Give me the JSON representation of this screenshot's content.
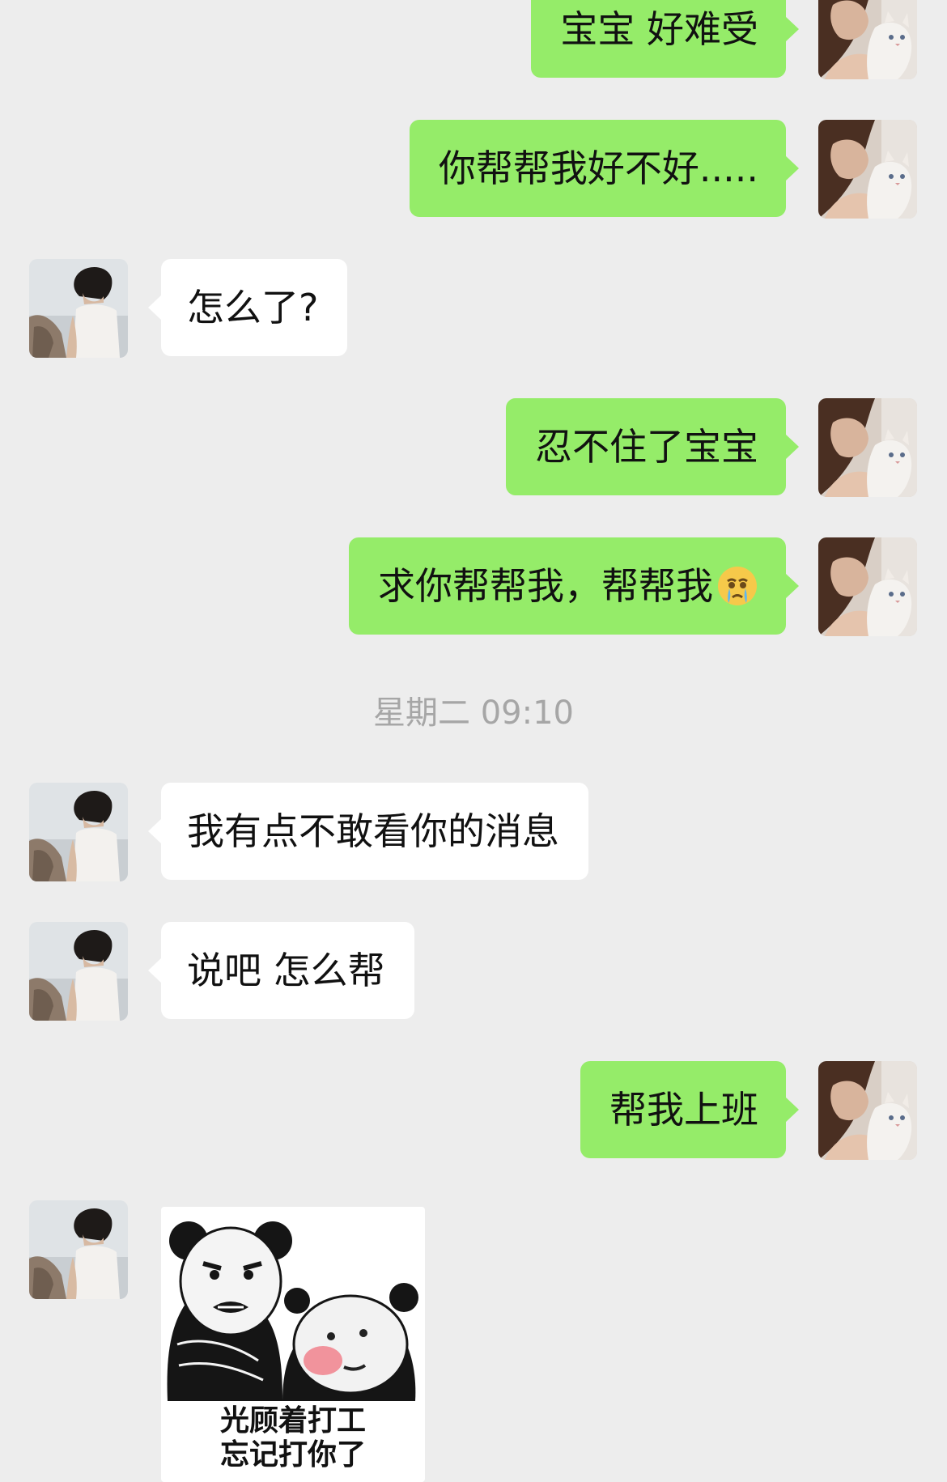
{
  "messages": {
    "m1": "宝宝 好难受",
    "m2": "你帮帮我好不好.....",
    "m3": "怎么了?",
    "m4": "忍不住了宝宝",
    "m5": "求你帮帮我，帮帮我",
    "m7": "我有点不敢看你的消息",
    "m8": "说吧 怎么帮",
    "m9": "帮我上班"
  },
  "timestamp": "星期二 09:10",
  "sticker": {
    "line1": "光顾着打工",
    "line2": "忘记打你了"
  },
  "icons": {
    "user_avatar": "woman-with-cat-avatar",
    "friend_avatar": "man-at-sea-avatar",
    "emoji": "crying-face-emoji"
  },
  "colors": {
    "background": "#ededed",
    "outgoing_bubble": "#95ec69",
    "incoming_bubble": "#ffffff",
    "timestamp_text": "#a6a6a6"
  }
}
